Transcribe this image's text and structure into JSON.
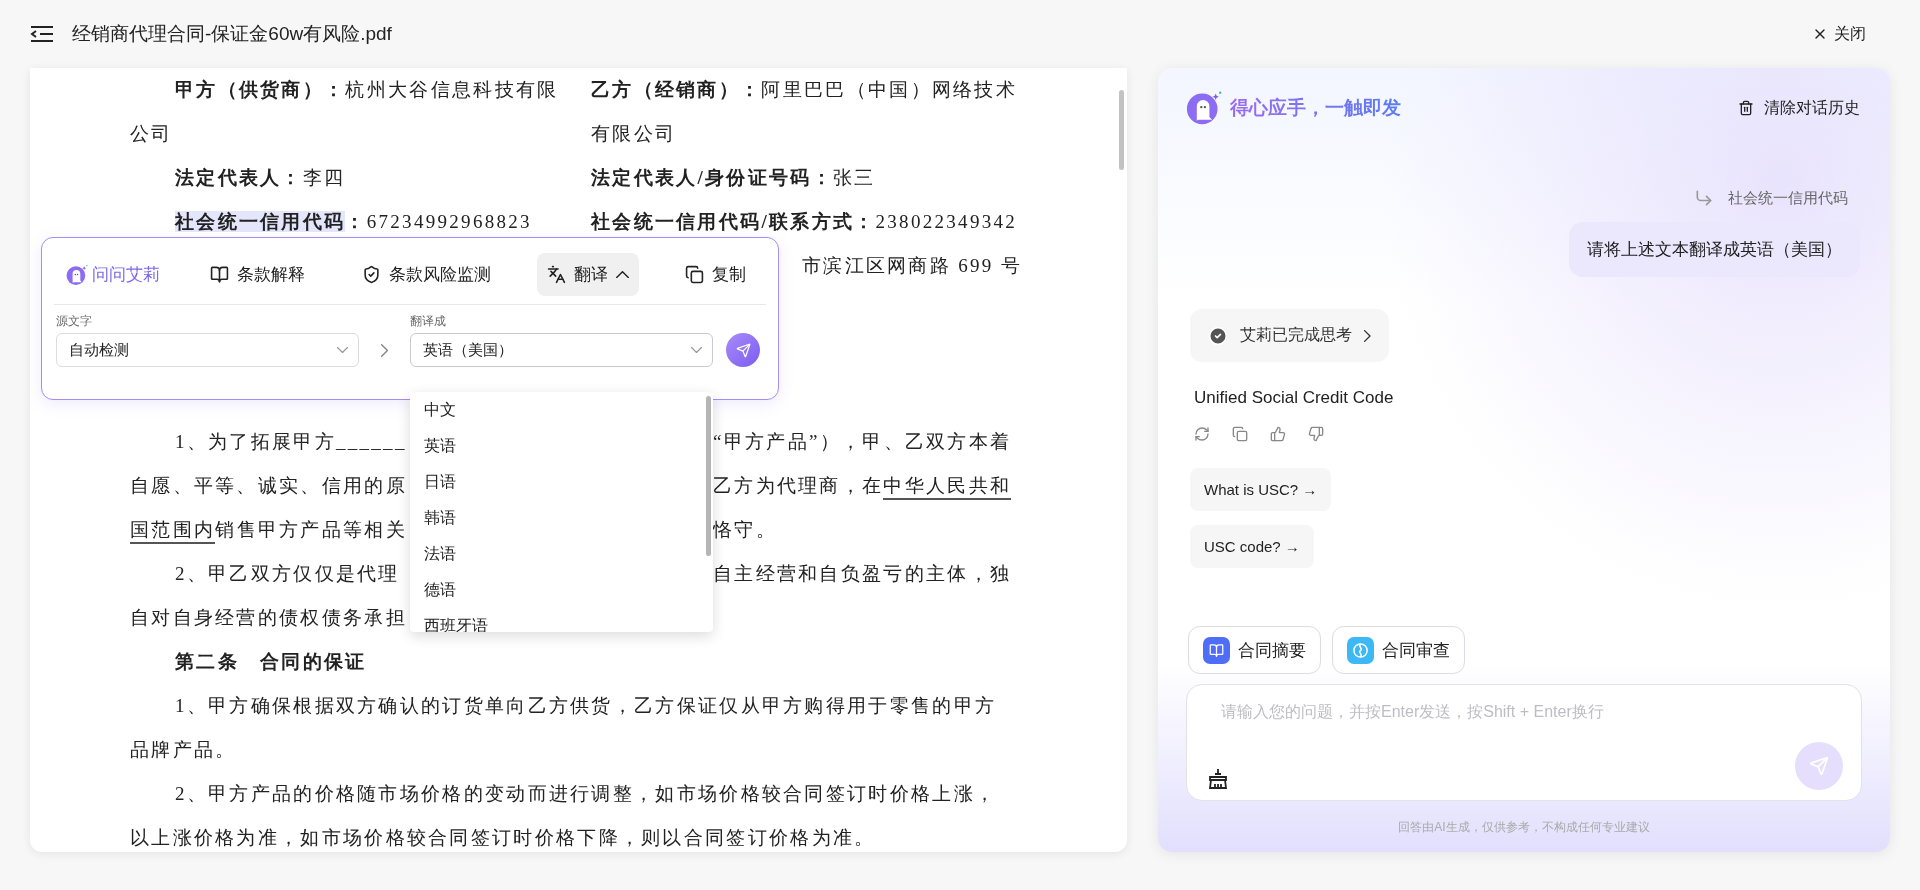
{
  "header": {
    "title": "经销商代理合同-保证金60w有风险.pdf",
    "close_label": "关闭"
  },
  "document": {
    "lines": [
      {
        "kind": "pair",
        "left": {
          "indent": true,
          "runs": [
            {
              "text": "甲方（供货商）：",
              "bold": true
            },
            {
              "text": "杭州大谷信息科技有限"
            }
          ]
        },
        "right": {
          "runs": [
            {
              "text": "乙方（经销商）：",
              "bold": true
            },
            {
              "text": "阿里巴巴（中国）网络技术"
            }
          ]
        }
      },
      {
        "kind": "pair",
        "left": {
          "indent": false,
          "runs": [
            {
              "text": "公司"
            }
          ]
        },
        "right": {
          "runs": [
            {
              "text": "有限公司"
            }
          ]
        }
      },
      {
        "kind": "pair",
        "left": {
          "indent": true,
          "runs": [
            {
              "text": "法定代表人：",
              "bold": true
            },
            {
              "text": "李四"
            }
          ]
        },
        "right": {
          "runs": [
            {
              "text": "法定代表人/身份证号码：",
              "bold": true
            },
            {
              "text": "张三"
            }
          ]
        }
      },
      {
        "kind": "pair",
        "left": {
          "indent": true,
          "runs": [
            {
              "text": "社会统一信用代码",
              "bold": true,
              "highlight": true
            },
            {
              "text": "：",
              "bold": true
            },
            {
              "text": "67234992968823"
            }
          ]
        },
        "right": {
          "runs": [
            {
              "text": "社会统一信用代码/联系方式：",
              "bold": true
            },
            {
              "text": "238022349342"
            }
          ]
        }
      },
      {
        "kind": "tail",
        "runs": [
          {
            "text": "市滨江区网商路 699 号"
          }
        ]
      },
      {
        "kind": "blank"
      },
      {
        "kind": "blank"
      },
      {
        "kind": "blank"
      },
      {
        "kind": "split",
        "left": {
          "indent": true,
          "runs": [
            {
              "text": "1、为了拓展甲方______"
            }
          ]
        },
        "right": {
          "runs": [
            {
              "text": "“甲方产品”），甲、乙双方本着"
            }
          ]
        }
      },
      {
        "kind": "split",
        "left": {
          "indent": false,
          "runs": [
            {
              "text": "自愿、平等、诚实、信用的原"
            }
          ]
        },
        "right": {
          "runs": [
            {
              "text": "乙方为代理商，在"
            },
            {
              "text": "中华人民共和",
              "underline": true
            }
          ]
        }
      },
      {
        "kind": "split",
        "left": {
          "indent": false,
          "runs": [
            {
              "text": "国范围内",
              "underline": true
            },
            {
              "text": "销售甲方产品等相关"
            }
          ]
        },
        "right": {
          "runs": [
            {
              "text": "恪守。"
            }
          ]
        }
      },
      {
        "kind": "split",
        "left": {
          "indent": true,
          "runs": [
            {
              "text": "2、甲乙双方仅仅是代理"
            }
          ]
        },
        "right": {
          "runs": [
            {
              "text": "自主经营和自负盈亏的主体，独"
            }
          ]
        }
      },
      {
        "kind": "split",
        "left": {
          "indent": false,
          "runs": [
            {
              "text": "自对自身经营的债权债务承担"
            }
          ]
        }
      },
      {
        "kind": "heading",
        "runs": [
          {
            "text": "第二条　合同的保证"
          }
        ]
      },
      {
        "kind": "para",
        "indent": true,
        "runs": [
          {
            "text": "1、甲方确保根据双方确认的订货单向乙方供货，乙方保证仅从甲方购得用于零售的甲方"
          }
        ]
      },
      {
        "kind": "para",
        "indent": false,
        "runs": [
          {
            "text": "品牌产品。"
          }
        ]
      },
      {
        "kind": "para",
        "indent": true,
        "runs": [
          {
            "text": "2、甲方产品的价格随市场价格的变动而进行调整，如市场价格较合同签订时价格上涨，"
          }
        ]
      },
      {
        "kind": "para",
        "indent": false,
        "runs": [
          {
            "text": "以上涨价格为准，如市场价格较合同签订时价格下降，则以合同签订价格为准。"
          }
        ]
      }
    ]
  },
  "selection_toolbar": {
    "assistant_label": "问问艾莉",
    "actions": [
      {
        "kind": "explain",
        "label": "条款解释",
        "selected": false,
        "expanded": false
      },
      {
        "kind": "risk",
        "label": "条款风险监测",
        "selected": false,
        "expanded": false
      },
      {
        "kind": "translate",
        "label": "翻译",
        "selected": true,
        "expanded": true
      },
      {
        "kind": "copy",
        "label": "复制",
        "selected": false,
        "expanded": false
      }
    ],
    "source": {
      "label": "源文字",
      "value": "自动检测"
    },
    "target": {
      "label": "翻译成",
      "value": "英语（美国）",
      "expanded": true,
      "options": [
        "中文",
        "英语",
        "日语",
        "韩语",
        "法语",
        "德语",
        "西班牙语"
      ]
    }
  },
  "assistant": {
    "title": "得心应手，一触即发",
    "clear_label": "清除对话历史",
    "quote": "社会统一信用代码",
    "user_message": "请将上述文本翻译成英语（美国）",
    "thinking_status": "艾莉已完成思考",
    "answer": "Unified Social Credit Code",
    "suggestions": [
      "What is USC? →",
      "USC code? →"
    ],
    "quick_actions": [
      {
        "kind": "summary",
        "label": "合同摘要"
      },
      {
        "kind": "review",
        "label": "合同审查"
      }
    ],
    "input": {
      "placeholder": "请输入您的问题，并按Enter发送，按Shift + Enter换行",
      "send_disabled": true
    },
    "disclaimer": "回答由AI生成，仅供参考，不构成任何专业建议"
  }
}
